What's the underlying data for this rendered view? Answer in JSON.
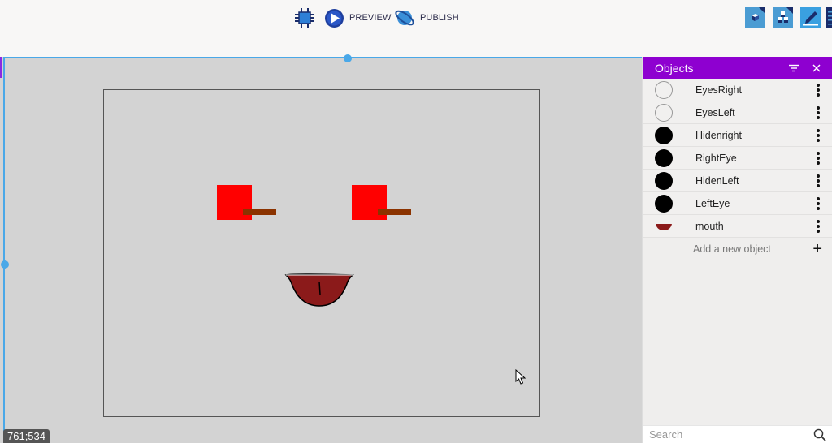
{
  "toolbar": {
    "debug_icon": "debugger-chip-icon",
    "preview_label": "PREVIEW",
    "publish_label": "PUBLISH",
    "right_icons": [
      "object-editor-icon",
      "objects-group-icon",
      "edit-icon",
      "list-icon"
    ]
  },
  "canvas": {
    "coords_readout": "761;534",
    "scene_objects": {
      "eye_color": "#ff0000",
      "brow_color": "#8b3300",
      "mouth_color": "#8b1a1a"
    }
  },
  "panel": {
    "title": "Objects",
    "header_color": "#8e00d0",
    "objects": [
      {
        "name": "EyesRight",
        "thumb": "empty-circle"
      },
      {
        "name": "EyesLeft",
        "thumb": "empty-circle"
      },
      {
        "name": "Hidenright",
        "thumb": "black-circle"
      },
      {
        "name": "RightEye",
        "thumb": "black-circle"
      },
      {
        "name": "HidenLeft",
        "thumb": "black-circle"
      },
      {
        "name": "LeftEye",
        "thumb": "black-circle"
      },
      {
        "name": "mouth",
        "thumb": "mouth"
      }
    ],
    "add_label": "Add a new object",
    "search_placeholder": "Search"
  }
}
